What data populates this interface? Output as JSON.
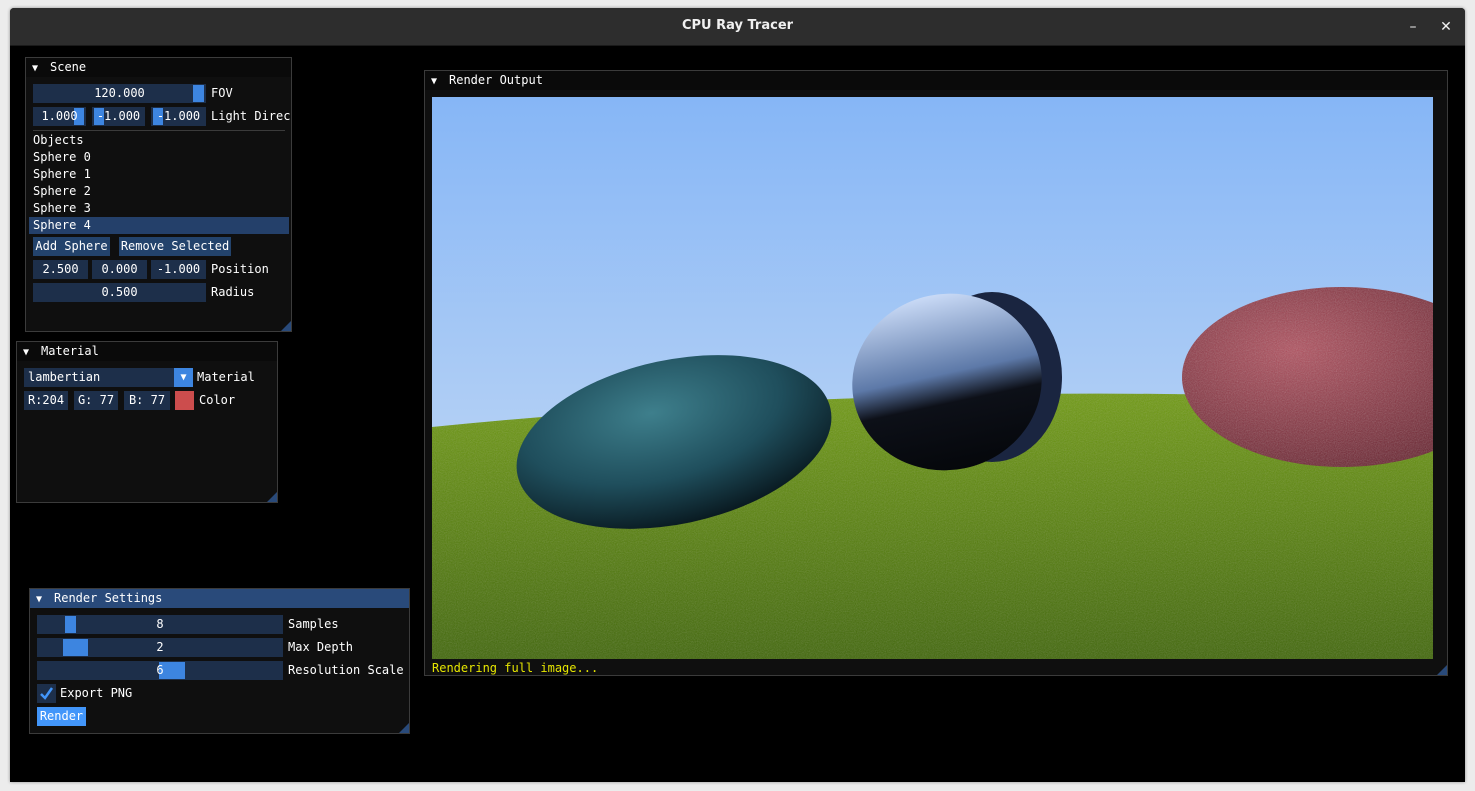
{
  "window": {
    "title": "CPU Ray Tracer",
    "minimize": "–",
    "close": "✕"
  },
  "scene": {
    "header": "Scene",
    "fov": {
      "value": "120.000",
      "label": "FOV"
    },
    "light": {
      "x": "1.000",
      "y": "-1.000",
      "z": "-1.000",
      "label": "Light Direct"
    },
    "objects_label": "Objects",
    "objects": [
      "Sphere 0",
      "Sphere 1",
      "Sphere 2",
      "Sphere 3",
      "Sphere 4"
    ],
    "add_button": "Add Sphere",
    "remove_button": "Remove Selected",
    "position": {
      "x": "2.500",
      "y": "0.000",
      "z": "-1.000",
      "label": "Position"
    },
    "radius": {
      "value": "0.500",
      "label": "Radius"
    }
  },
  "material": {
    "header": "Material",
    "type_value": "lambertian",
    "type_label": "Material",
    "color": {
      "r": "R:204",
      "g": "G: 77",
      "b": "B: 77",
      "label": "Color",
      "hex": "#cc4d4d"
    }
  },
  "render_settings": {
    "header": "Render Settings",
    "samples": {
      "value": "8",
      "label": "Samples"
    },
    "max_depth": {
      "value": "2",
      "label": "Max Depth"
    },
    "resolution_scale": {
      "value": "6",
      "label": "Resolution Scale"
    },
    "export_png": {
      "label": "Export PNG",
      "checked": true
    },
    "render_button": "Render"
  },
  "render_output": {
    "header": "Render Output",
    "status": "Rendering full image..."
  },
  "colors": {
    "accent": "#4296fa",
    "frame": "#1d2f4a",
    "status": "#e6e600"
  }
}
